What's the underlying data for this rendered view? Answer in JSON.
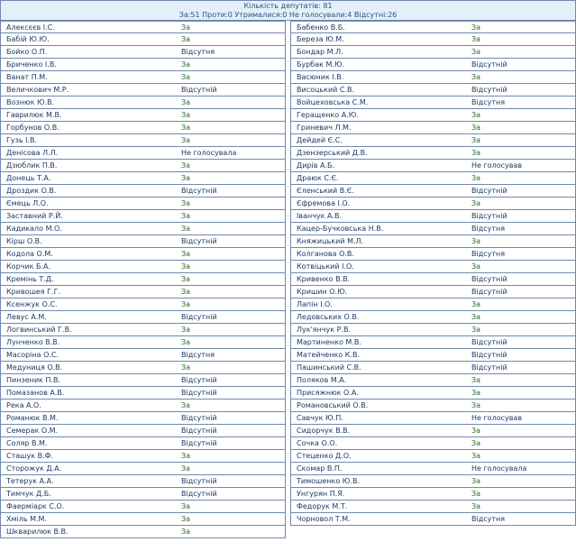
{
  "summary": {
    "total_line": "Кількість депутатів: 81",
    "breakdown_line": "За:51 Проти:0 Утрималися:0 Не голосували:4 Відсутні:26",
    "counts": {
      "total": 81,
      "za": 51,
      "proty": 0,
      "utrymalysia": 0,
      "ne_golosuvaly": 4,
      "vidsutni": 26
    }
  },
  "colors": {
    "panel_bg": "#e3f0f9",
    "border": "#7189ae",
    "name_text": "#1f3864",
    "vote_za_text": "#2a6b2a"
  },
  "columns": {
    "left": [
      {
        "name": "Алексєєв І.С.",
        "vote": "За",
        "kind": "za"
      },
      {
        "name": "Бабій Ю.Ю.",
        "vote": "За",
        "kind": "za"
      },
      {
        "name": "Бойко О.П.",
        "vote": "Відсутня",
        "kind": "absent"
      },
      {
        "name": "Бриченко І.В.",
        "vote": "За",
        "kind": "za"
      },
      {
        "name": "Ванат П.М.",
        "vote": "За",
        "kind": "za"
      },
      {
        "name": "Величкович М.Р.",
        "vote": "Відсутній",
        "kind": "absent"
      },
      {
        "name": "Вознюк Ю.В.",
        "vote": "За",
        "kind": "za"
      },
      {
        "name": "Гаврилюк М.В.",
        "vote": "За",
        "kind": "za"
      },
      {
        "name": "Горбунов О.В.",
        "vote": "За",
        "kind": "za"
      },
      {
        "name": "Гузь І.В.",
        "vote": "За",
        "kind": "za"
      },
      {
        "name": "Денісова Л.Л.",
        "vote": "Не голосувала",
        "kind": "novote"
      },
      {
        "name": "Дзюблик П.В.",
        "vote": "За",
        "kind": "za"
      },
      {
        "name": "Донець Т.А.",
        "vote": "За",
        "kind": "za"
      },
      {
        "name": "Дроздик О.В.",
        "vote": "Відсутній",
        "kind": "absent"
      },
      {
        "name": "Ємець Л.О.",
        "vote": "За",
        "kind": "za"
      },
      {
        "name": "Заставний Р.Й.",
        "vote": "За",
        "kind": "za"
      },
      {
        "name": "Кадикало М.О.",
        "vote": "За",
        "kind": "za"
      },
      {
        "name": "Кірш О.В.",
        "vote": "Відсутній",
        "kind": "absent"
      },
      {
        "name": "Кодола О.М.",
        "vote": "За",
        "kind": "za"
      },
      {
        "name": "Корчик Б.А.",
        "vote": "За",
        "kind": "za"
      },
      {
        "name": "Кремінь Т.Д.",
        "vote": "За",
        "kind": "za"
      },
      {
        "name": "Кривошея Г.Г.",
        "vote": "За",
        "kind": "za"
      },
      {
        "name": "Ксенжук О.С.",
        "vote": "За",
        "kind": "za"
      },
      {
        "name": "Левус А.М.",
        "vote": "Відсутній",
        "kind": "absent"
      },
      {
        "name": "Логвинський Г.В.",
        "vote": "За",
        "kind": "za"
      },
      {
        "name": "Лунченко В.В.",
        "vote": "За",
        "kind": "za"
      },
      {
        "name": "Масоріна О.С.",
        "vote": "Відсутня",
        "kind": "absent"
      },
      {
        "name": "Медуниця О.В.",
        "vote": "За",
        "kind": "za"
      },
      {
        "name": "Пинзеник П.В.",
        "vote": "Відсутній",
        "kind": "absent"
      },
      {
        "name": "Помазанов А.В.",
        "vote": "Відсутній",
        "kind": "absent"
      },
      {
        "name": "Река А.О.",
        "vote": "За",
        "kind": "za"
      },
      {
        "name": "Романюк В.М.",
        "vote": "Відсутній",
        "kind": "absent"
      },
      {
        "name": "Семерак О.М.",
        "vote": "Відсутній",
        "kind": "absent"
      },
      {
        "name": "Соляр В.М.",
        "vote": "Відсутній",
        "kind": "absent"
      },
      {
        "name": "Сташук В.Ф.",
        "vote": "За",
        "kind": "za"
      },
      {
        "name": "Сторожук Д.А.",
        "vote": "За",
        "kind": "za"
      },
      {
        "name": "Тетерук А.А.",
        "vote": "Відсутній",
        "kind": "absent"
      },
      {
        "name": "Тимчук Д.Б.",
        "vote": "Відсутній",
        "kind": "absent"
      },
      {
        "name": "Фаерміарк С.О.",
        "vote": "За",
        "kind": "za"
      },
      {
        "name": "Хміль М.М.",
        "vote": "За",
        "kind": "za"
      },
      {
        "name": "Шкварилюк В.В.",
        "vote": "За",
        "kind": "za"
      }
    ],
    "right": [
      {
        "name": "Бабенко В.Б.",
        "vote": "За",
        "kind": "za"
      },
      {
        "name": "Береза Ю.М.",
        "vote": "За",
        "kind": "za"
      },
      {
        "name": "Бондар М.Л.",
        "vote": "За",
        "kind": "za"
      },
      {
        "name": "Бурбак М.Ю.",
        "vote": "Відсутній",
        "kind": "absent"
      },
      {
        "name": "Васюник І.В.",
        "vote": "За",
        "kind": "za"
      },
      {
        "name": "Висоцький С.В.",
        "vote": "Відсутній",
        "kind": "absent"
      },
      {
        "name": "Войцеховська С.М.",
        "vote": "Відсутня",
        "kind": "absent"
      },
      {
        "name": "Геращенко А.Ю.",
        "vote": "За",
        "kind": "za"
      },
      {
        "name": "Гриневич Л.М.",
        "vote": "За",
        "kind": "za"
      },
      {
        "name": "Дейдей Є.С.",
        "vote": "За",
        "kind": "za"
      },
      {
        "name": "Дзензерський Д.В.",
        "vote": "За",
        "kind": "za"
      },
      {
        "name": "Дирів А.Б.",
        "vote": "Не голосував",
        "kind": "novote"
      },
      {
        "name": "Драюк С.Є.",
        "vote": "За",
        "kind": "za"
      },
      {
        "name": "Єленський В.Є.",
        "vote": "Відсутній",
        "kind": "absent"
      },
      {
        "name": "Єфремова І.О.",
        "vote": "За",
        "kind": "za"
      },
      {
        "name": "Іванчук А.В.",
        "vote": "Відсутній",
        "kind": "absent"
      },
      {
        "name": "Кацер-Бучковська Н.В.",
        "vote": "Відсутня",
        "kind": "absent"
      },
      {
        "name": "Княжицький М.Л.",
        "vote": "За",
        "kind": "za"
      },
      {
        "name": "Колганова О.В.",
        "vote": "Відсутня",
        "kind": "absent"
      },
      {
        "name": "Котвіцький І.О.",
        "vote": "За",
        "kind": "za"
      },
      {
        "name": "Кривенко В.В.",
        "vote": "Відсутній",
        "kind": "absent"
      },
      {
        "name": "Кришин О.Ю.",
        "vote": "Відсутній",
        "kind": "absent"
      },
      {
        "name": "Лапін І.О.",
        "vote": "За",
        "kind": "za"
      },
      {
        "name": "Ледовських О.В.",
        "vote": "За",
        "kind": "za"
      },
      {
        "name": "Лук'янчук Р.В.",
        "vote": "За",
        "kind": "za"
      },
      {
        "name": "Мартиненко М.В.",
        "vote": "Відсутній",
        "kind": "absent"
      },
      {
        "name": "Матейченко К.В.",
        "vote": "Відсутній",
        "kind": "absent"
      },
      {
        "name": "Пашинський С.В.",
        "vote": "Відсутній",
        "kind": "absent"
      },
      {
        "name": "Поляков М.А.",
        "vote": "За",
        "kind": "za"
      },
      {
        "name": "Присяжнюк О.А.",
        "vote": "За",
        "kind": "za"
      },
      {
        "name": "Романовський О.В.",
        "vote": "За",
        "kind": "za"
      },
      {
        "name": "Савчук Ю.П.",
        "vote": "Не голосував",
        "kind": "novote"
      },
      {
        "name": "Сидорчук В.В.",
        "vote": "За",
        "kind": "za"
      },
      {
        "name": "Сочка О.О.",
        "vote": "За",
        "kind": "za"
      },
      {
        "name": "Стеценко Д.О.",
        "vote": "За",
        "kind": "za"
      },
      {
        "name": "Скомар В.П.",
        "vote": "Не голосувала",
        "kind": "novote"
      },
      {
        "name": "Тимошенко Ю.В.",
        "vote": "За",
        "kind": "za"
      },
      {
        "name": "Унгурян П.Я.",
        "vote": "За",
        "kind": "za"
      },
      {
        "name": "Федорук М.Т.",
        "vote": "За",
        "kind": "za"
      },
      {
        "name": "Чорновол Т.М.",
        "vote": "Відсутня",
        "kind": "absent"
      }
    ]
  }
}
